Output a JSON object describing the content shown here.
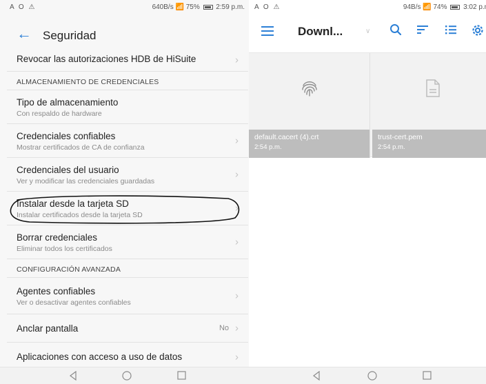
{
  "left": {
    "status": {
      "left_icons": "A O ⚠",
      "speed": "640B/s",
      "battery": "75%",
      "time": "2:59 p.m."
    },
    "appbar": {
      "title": "Seguridad"
    },
    "items": [
      {
        "title": "Revocar las autorizaciones HDB de HiSuite"
      },
      {
        "header": "ALMACENAMIENTO DE CREDENCIALES"
      },
      {
        "title": "Tipo de almacenamiento",
        "subtitle": "Con respaldo de hardware"
      },
      {
        "title": "Credenciales confiables",
        "subtitle": "Mostrar certificados de CA de confianza"
      },
      {
        "title": "Credenciales del usuario",
        "subtitle": "Ver y modificar las credenciales guardadas"
      },
      {
        "title": "Instalar desde la tarjeta SD",
        "subtitle": "Instalar certificados desde la tarjeta SD"
      },
      {
        "title": "Borrar credenciales",
        "subtitle": "Eliminar todos los certificados"
      },
      {
        "header": "CONFIGURACIÓN AVANZADA"
      },
      {
        "title": "Agentes confiables",
        "subtitle": "Ver o desactivar agentes confiables"
      },
      {
        "title": "Anclar pantalla",
        "value": "No"
      },
      {
        "title": "Aplicaciones con acceso a uso de datos"
      }
    ]
  },
  "right": {
    "status": {
      "left_icons": "A O ⚠",
      "speed": "94B/s",
      "battery": "74%",
      "time": "3:02 p.m"
    },
    "appbar": {
      "title": "Downl..."
    },
    "files": [
      {
        "name": "default.cacert (4).crt",
        "time": "2:54 p.m.",
        "icon": "fingerprint-icon"
      },
      {
        "name": "trust-cert.pem",
        "time": "2:54 p.m.",
        "icon": "document-icon"
      }
    ]
  },
  "colors": {
    "accent": "#2b7fd6",
    "caption_bg": "#bdbdbd",
    "divider": "#e2e2e2"
  }
}
